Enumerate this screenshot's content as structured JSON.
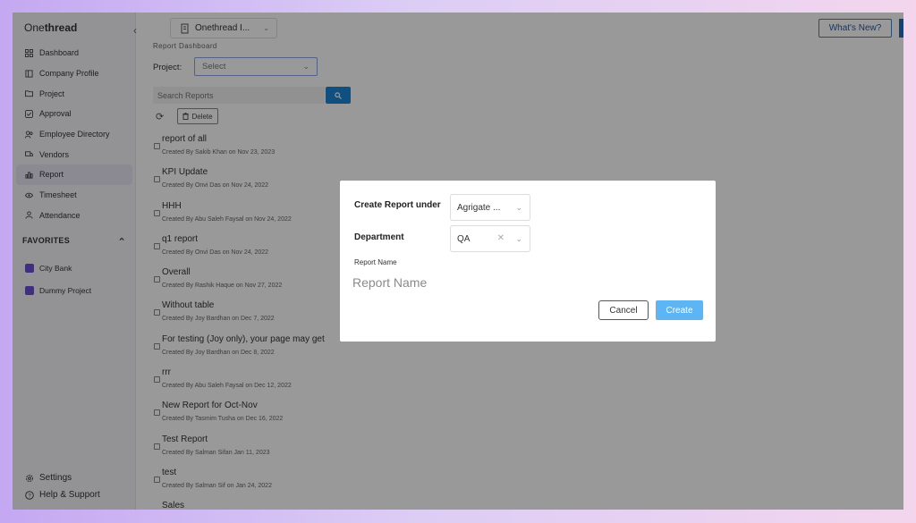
{
  "app": {
    "logo_light": "One",
    "logo_bold": "thread",
    "collapse_icon": "‹"
  },
  "sidebar": {
    "items": [
      {
        "label": "Dashboard",
        "icon": "grid-icon"
      },
      {
        "label": "Company Profile",
        "icon": "building-icon"
      },
      {
        "label": "Project",
        "icon": "folder-icon"
      },
      {
        "label": "Approval",
        "icon": "check-icon"
      },
      {
        "label": "Employee Directory",
        "icon": "people-icon"
      },
      {
        "label": "Vendors",
        "icon": "truck-icon"
      },
      {
        "label": "Report",
        "icon": "chart-icon",
        "active": true
      },
      {
        "label": "Timesheet",
        "icon": "eye-icon"
      },
      {
        "label": "Attendance",
        "icon": "user-icon"
      }
    ],
    "favorites_title": "FAVORITES",
    "favorites_toggle": "⌃",
    "favorites": [
      "City Bank",
      "Dummy Project"
    ],
    "bottom": [
      "Settings",
      "Help & Support"
    ]
  },
  "topbar": {
    "org_select": "Onethread I...",
    "whats_new": "What's New?"
  },
  "main": {
    "section_label": "Report Dashboard",
    "project_label": "Project:",
    "project_select": "Select",
    "search_placeholder": "Search Reports",
    "delete_label": "Delete",
    "reports": [
      {
        "title": "report of all",
        "meta": "Created By Sakib Khan on Nov 23, 2023"
      },
      {
        "title": "KPI Update",
        "meta": "Created By Onvi Das on Nov 24, 2022"
      },
      {
        "title": "HHH",
        "meta": "Created By Abu Saleh Faysal on Nov 24, 2022"
      },
      {
        "title": "q1 report",
        "meta": "Created By Onvi Das on Nov 24, 2022"
      },
      {
        "title": "Overall",
        "meta": "Created By Rashik Haque on Nov 27, 2022"
      },
      {
        "title": "Without table",
        "meta": "Created By Joy Bardhan on Dec 7, 2022"
      },
      {
        "title": "For testing (Joy only), your page may get",
        "meta": "Created By Joy Bardhan on Dec 8, 2022"
      },
      {
        "title": "rrr",
        "meta": "Created By Abu Saleh Faysal on Dec 12, 2022"
      },
      {
        "title": "New Report for Oct-Nov",
        "meta": "Created By Tasmim Tusha on Dec 16, 2022"
      },
      {
        "title": "Test Report",
        "meta": "Created By Salman Sifan Jan 11, 2023"
      },
      {
        "title": "test",
        "meta": "Created By Salman Sif on Jan 24, 2022"
      },
      {
        "title": "Sales",
        "meta": ""
      }
    ]
  },
  "modal": {
    "create_under_label": "Create Report under",
    "create_under_value": "Agrigate ...",
    "department_label": "Department",
    "department_value": "QA",
    "report_name_label": "Report Name",
    "report_name_placeholder": "Report Name",
    "cancel": "Cancel",
    "create": "Create"
  },
  "colors": {
    "accent": "#1a86d8",
    "favorite": "#6c4fd8",
    "create_button": "#5db6f3"
  }
}
